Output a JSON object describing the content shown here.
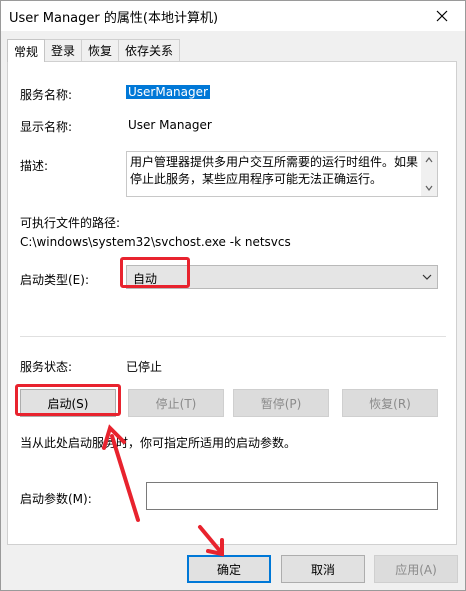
{
  "window": {
    "title": "User Manager 的属性(本地计算机)"
  },
  "tabs": [
    {
      "label": "常规",
      "active": true
    },
    {
      "label": "登录",
      "active": false
    },
    {
      "label": "恢复",
      "active": false
    },
    {
      "label": "依存关系",
      "active": false
    }
  ],
  "general": {
    "service_name_label": "服务名称:",
    "service_name_value": "UserManager",
    "display_name_label": "显示名称:",
    "display_name_value": "User Manager",
    "description_label": "描述:",
    "description_value": "用户管理器提供多用户交互所需要的运行时组件。如果停止此服务，某些应用程序可能无法正确运行。",
    "path_label": "可执行文件的路径:",
    "path_value": "C:\\windows\\system32\\svchost.exe -k netsvcs",
    "startup_type_label": "启动类型(E):",
    "startup_type_value": "自动",
    "service_status_label": "服务状态:",
    "service_status_value": "已停止",
    "start_button": "启动(S)",
    "stop_button": "停止(T)",
    "pause_button": "暂停(P)",
    "resume_button": "恢复(R)",
    "hint_text": "当从此处启动服务时，你可指定所适用的启动参数。",
    "start_params_label": "启动参数(M):",
    "start_params_value": ""
  },
  "footer": {
    "ok_button": "确定",
    "cancel_button": "取消",
    "apply_button": "应用(A)"
  },
  "annotation_color": "#e8232e",
  "accent_color": "#0078d7"
}
